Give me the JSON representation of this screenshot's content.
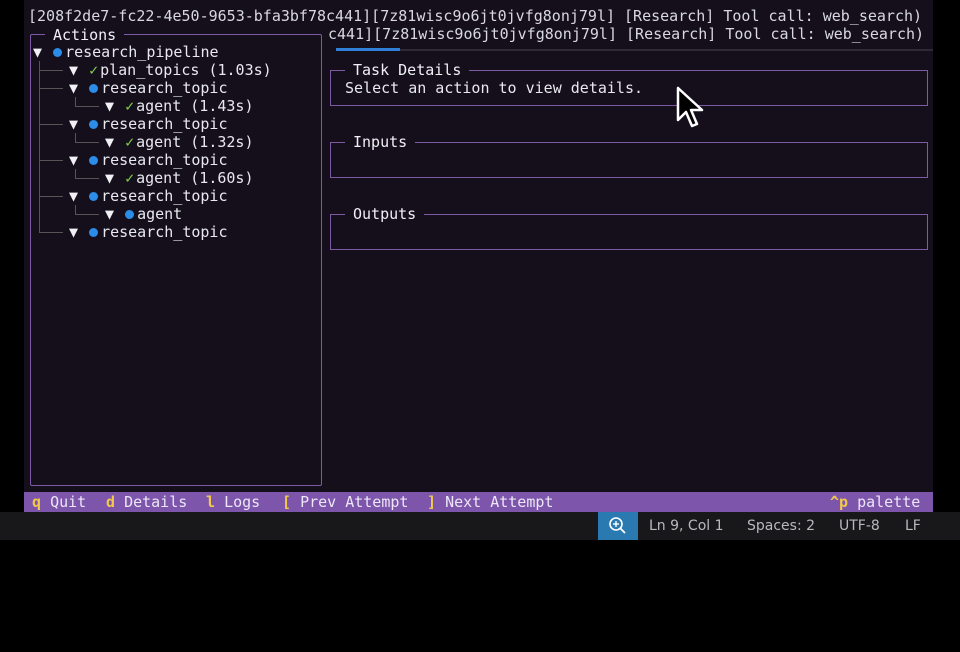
{
  "log_lines": [
    "[208f2de7-fc22-4e50-9653-bfa3bf78c441][7z81wisc9o6jt0jvfg8onj79l] [Research] Tool call: web_search)",
    "c441][7z81wisc9o6jt0jvfg8onj79l] [Research] Tool call: web_search)"
  ],
  "actions_panel": {
    "title": "Actions",
    "tree": [
      {
        "indent": 0,
        "status": "running",
        "label": "research_pipeline"
      },
      {
        "indent": 1,
        "status": "done",
        "label": "plan_topics (1.03s)"
      },
      {
        "indent": 1,
        "status": "running",
        "label": "research_topic"
      },
      {
        "indent": 2,
        "status": "done",
        "label": "agent (1.43s)"
      },
      {
        "indent": 1,
        "status": "running",
        "label": "research_topic"
      },
      {
        "indent": 2,
        "status": "done",
        "label": "agent (1.32s)"
      },
      {
        "indent": 1,
        "status": "running",
        "label": "research_topic"
      },
      {
        "indent": 2,
        "status": "done",
        "label": "agent (1.60s)"
      },
      {
        "indent": 1,
        "status": "running",
        "label": "research_topic"
      },
      {
        "indent": 2,
        "status": "running",
        "label": "agent"
      },
      {
        "indent": 1,
        "status": "running",
        "label": "research_topic"
      }
    ]
  },
  "task_details": {
    "title": "Task Details",
    "body": "Select an action to view details."
  },
  "inputs": {
    "title": "Inputs",
    "body": ""
  },
  "outputs": {
    "title": "Outputs",
    "body": ""
  },
  "keybar": [
    {
      "key": "q",
      "label": "Quit"
    },
    {
      "key": "d",
      "label": "Details"
    },
    {
      "key": "l",
      "label": "Logs"
    },
    {
      "key": "[",
      "label": "Prev Attempt"
    },
    {
      "key": "]",
      "label": "Next Attempt"
    },
    {
      "key": "^p",
      "label": "palette"
    }
  ],
  "statusbar": {
    "zoom_icon": "zoom-in-icon",
    "position": "Ln 9, Col 1",
    "spaces": "Spaces: 2",
    "encoding": "UTF-8",
    "eol": "LF"
  },
  "colors": {
    "accent": "#7e5aa6",
    "running": "#2b8de8",
    "done": "#7bd14a",
    "key": "#f2c84b",
    "keybar_bg": "#7d56ac"
  }
}
